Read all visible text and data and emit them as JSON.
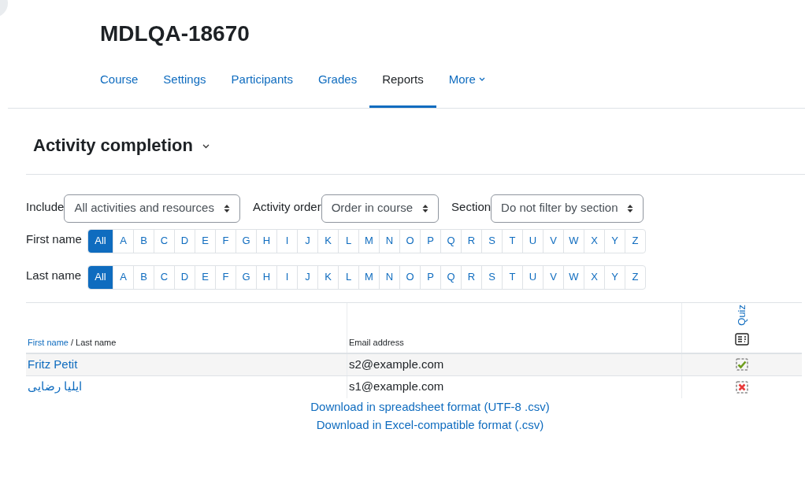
{
  "course": {
    "title": "MDLQA-18670"
  },
  "nav_tabs": [
    {
      "label": "Course",
      "selected": false,
      "kind": "link"
    },
    {
      "label": "Settings",
      "selected": false,
      "kind": "link"
    },
    {
      "label": "Participants",
      "selected": false,
      "kind": "link"
    },
    {
      "label": "Grades",
      "selected": false,
      "kind": "link"
    },
    {
      "label": "Reports",
      "selected": true,
      "kind": "link"
    },
    {
      "label": "More",
      "selected": false,
      "kind": "menu"
    }
  ],
  "report": {
    "title": "Activity completion"
  },
  "filters": [
    {
      "label": "Include",
      "value": "All activities and resources"
    },
    {
      "label": "Activity order",
      "value": "Order in course"
    },
    {
      "label": "Section",
      "value": "Do not filter by section"
    }
  ],
  "initials_bars": [
    {
      "label": "First name",
      "letters": [
        {
          "label": "All",
          "selected": true
        },
        {
          "label": "A",
          "selected": false
        },
        {
          "label": "B",
          "selected": false
        },
        {
          "label": "C",
          "selected": false
        },
        {
          "label": "D",
          "selected": false
        },
        {
          "label": "E",
          "selected": false
        },
        {
          "label": "F",
          "selected": false
        },
        {
          "label": "G",
          "selected": false
        },
        {
          "label": "H",
          "selected": false
        },
        {
          "label": "I",
          "selected": false
        },
        {
          "label": "J",
          "selected": false
        },
        {
          "label": "K",
          "selected": false
        },
        {
          "label": "L",
          "selected": false
        },
        {
          "label": "M",
          "selected": false
        },
        {
          "label": "N",
          "selected": false
        },
        {
          "label": "O",
          "selected": false
        },
        {
          "label": "P",
          "selected": false
        },
        {
          "label": "Q",
          "selected": false
        },
        {
          "label": "R",
          "selected": false
        },
        {
          "label": "S",
          "selected": false
        },
        {
          "label": "T",
          "selected": false
        },
        {
          "label": "U",
          "selected": false
        },
        {
          "label": "V",
          "selected": false
        },
        {
          "label": "W",
          "selected": false
        },
        {
          "label": "X",
          "selected": false
        },
        {
          "label": "Y",
          "selected": false
        },
        {
          "label": "Z",
          "selected": false
        }
      ]
    },
    {
      "label": "Last name",
      "letters": [
        {
          "label": "All",
          "selected": true
        },
        {
          "label": "A",
          "selected": false
        },
        {
          "label": "B",
          "selected": false
        },
        {
          "label": "C",
          "selected": false
        },
        {
          "label": "D",
          "selected": false
        },
        {
          "label": "E",
          "selected": false
        },
        {
          "label": "F",
          "selected": false
        },
        {
          "label": "G",
          "selected": false
        },
        {
          "label": "H",
          "selected": false
        },
        {
          "label": "I",
          "selected": false
        },
        {
          "label": "J",
          "selected": false
        },
        {
          "label": "K",
          "selected": false
        },
        {
          "label": "L",
          "selected": false
        },
        {
          "label": "M",
          "selected": false
        },
        {
          "label": "N",
          "selected": false
        },
        {
          "label": "O",
          "selected": false
        },
        {
          "label": "P",
          "selected": false
        },
        {
          "label": "Q",
          "selected": false
        },
        {
          "label": "R",
          "selected": false
        },
        {
          "label": "S",
          "selected": false
        },
        {
          "label": "T",
          "selected": false
        },
        {
          "label": "U",
          "selected": false
        },
        {
          "label": "V",
          "selected": false
        },
        {
          "label": "W",
          "selected": false
        },
        {
          "label": "X",
          "selected": false
        },
        {
          "label": "Y",
          "selected": false
        },
        {
          "label": "Z",
          "selected": false
        }
      ]
    }
  ],
  "table": {
    "name_header": {
      "first": "First name",
      "separator": "/",
      "last": "Last name"
    },
    "email_header": "Email address",
    "activity_header": "Quiz",
    "rows": [
      {
        "name": "Fritz Petit",
        "email": "s2@example.com",
        "completed": true
      },
      {
        "name": "ایلیا رضایی",
        "email": "s1@example.com",
        "completed": false
      }
    ]
  },
  "downloads": [
    "Download in spreadsheet format (UTF-8 .csv)",
    "Download in Excel-compatible format (.csv)"
  ]
}
